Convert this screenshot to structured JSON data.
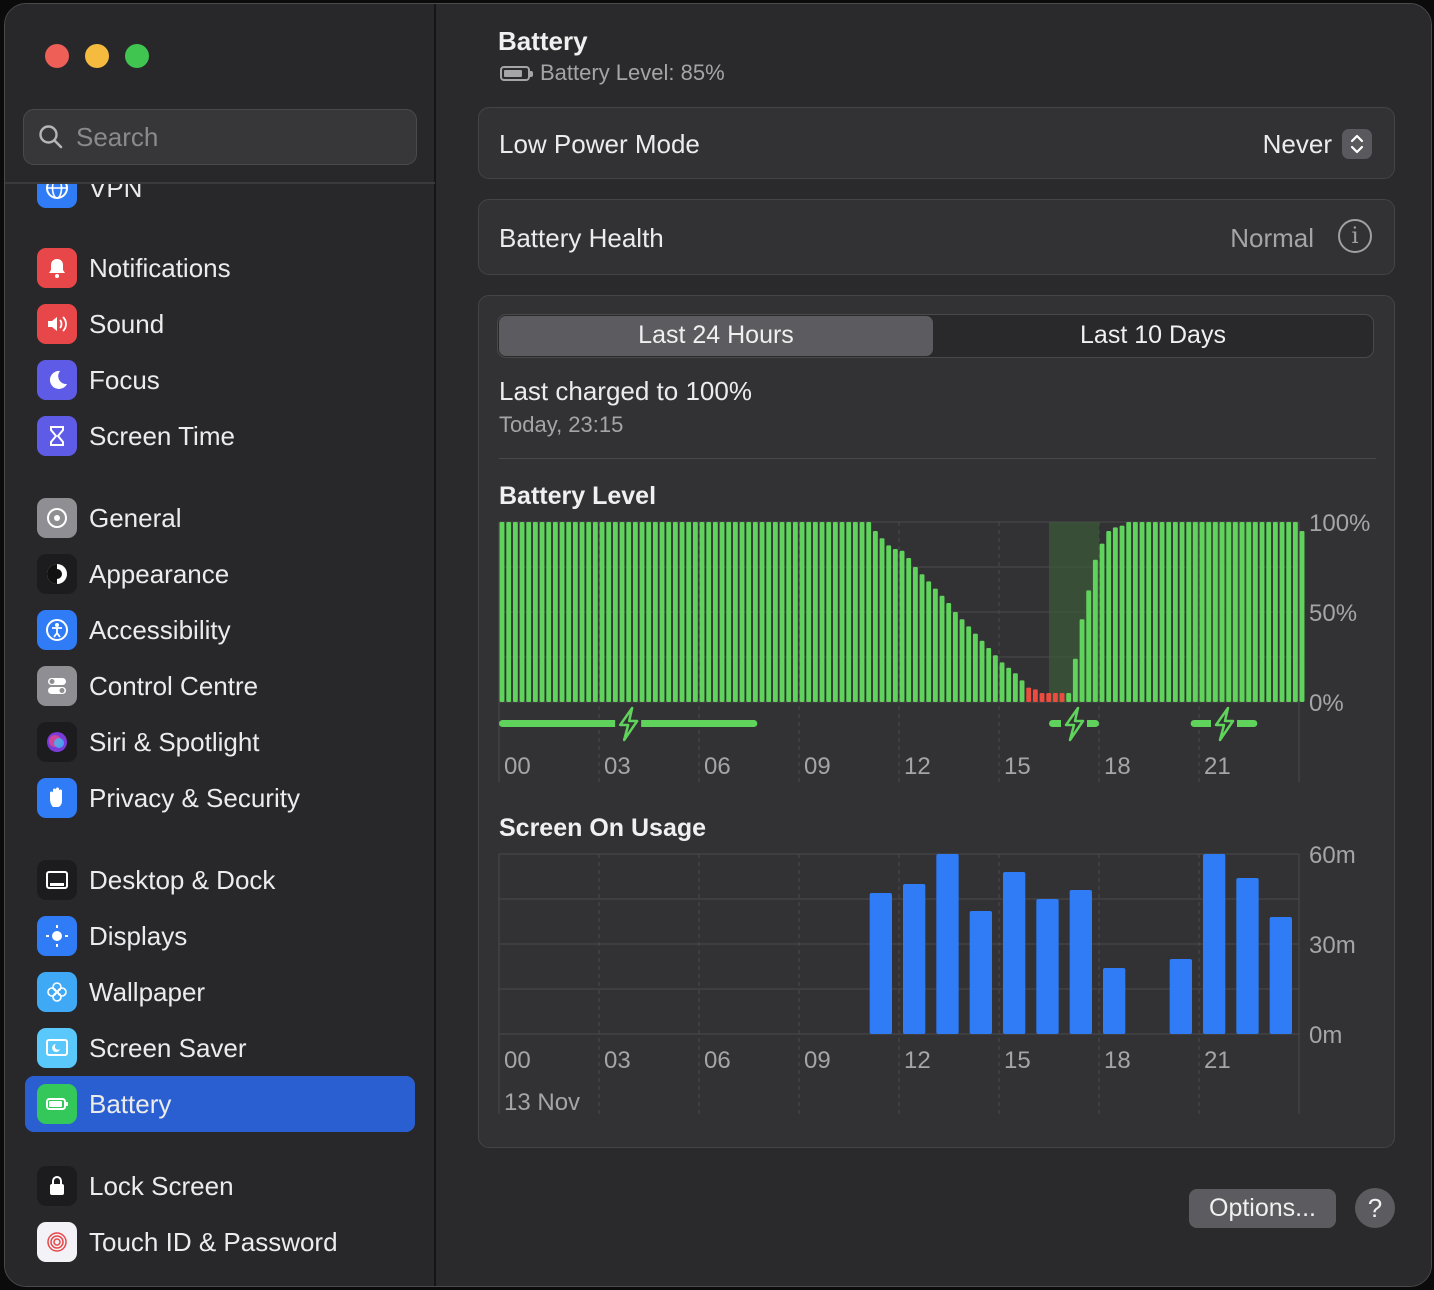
{
  "sidebar": {
    "search_placeholder": "Search",
    "partial_item": "VPN",
    "items": [
      {
        "label": "Notifications",
        "icon": "bell-icon",
        "color": "#e8474a"
      },
      {
        "label": "Sound",
        "icon": "speaker-icon",
        "color": "#e8474a"
      },
      {
        "label": "Focus",
        "icon": "moon-icon",
        "color": "#5e5ce6"
      },
      {
        "label": "Screen Time",
        "icon": "hourglass-icon",
        "color": "#5e5ce6"
      },
      {
        "label": "General",
        "icon": "gear-icon",
        "color": "#8e8e93"
      },
      {
        "label": "Appearance",
        "icon": "appearance-icon",
        "color": "#1c1c1e"
      },
      {
        "label": "Accessibility",
        "icon": "accessibility-icon",
        "color": "#2f7cf6"
      },
      {
        "label": "Control Centre",
        "icon": "toggles-icon",
        "color": "#8e8e93"
      },
      {
        "label": "Siri & Spotlight",
        "icon": "siri-icon",
        "color": "#1c1c1e"
      },
      {
        "label": "Privacy & Security",
        "icon": "hand-icon",
        "color": "#2f7cf6"
      },
      {
        "label": "Desktop & Dock",
        "icon": "dock-icon",
        "color": "#1c1c1e"
      },
      {
        "label": "Displays",
        "icon": "sun-icon",
        "color": "#2f7cf6"
      },
      {
        "label": "Wallpaper",
        "icon": "flower-icon",
        "color": "#3fa9f5"
      },
      {
        "label": "Screen Saver",
        "icon": "screensaver-icon",
        "color": "#5ac8fa"
      },
      {
        "label": "Battery",
        "icon": "battery-icon",
        "color": "#34c759"
      },
      {
        "label": "Lock Screen",
        "icon": "lock-icon",
        "color": "#1c1c1e"
      },
      {
        "label": "Touch ID & Password",
        "icon": "fingerprint-icon",
        "color": "#f2f2f7"
      }
    ],
    "active": "Battery"
  },
  "header": {
    "title": "Battery",
    "subtitle": "Battery Level: 85%"
  },
  "low_power": {
    "label": "Low Power Mode",
    "value": "Never"
  },
  "health": {
    "label": "Battery Health",
    "value": "Normal"
  },
  "tabs": {
    "items": [
      "Last 24 Hours",
      "Last 10 Days"
    ],
    "selected": "Last 24 Hours"
  },
  "last_charged": {
    "title": "Last charged to 100%",
    "time": "Today, 23:15"
  },
  "buttons": {
    "options": "Options...",
    "help": "?"
  },
  "colors": {
    "battery_bar": "#5fd35b",
    "battery_low": "#ec4b3f",
    "usage_bar": "#2f7cf6",
    "accent": "#2a5fd1"
  },
  "chart_data": [
    {
      "type": "bar",
      "title": "Battery Level",
      "x_ticks": [
        "00",
        "03",
        "06",
        "09",
        "12",
        "15",
        "18",
        "21"
      ],
      "y_ticks": [
        "100%",
        "50%",
        "0%"
      ],
      "ylim": [
        0,
        100
      ],
      "unit": "%",
      "interval_minutes": 15,
      "values": [
        100,
        100,
        100,
        100,
        100,
        100,
        100,
        100,
        100,
        100,
        100,
        100,
        100,
        100,
        100,
        100,
        100,
        100,
        100,
        100,
        100,
        100,
        100,
        100,
        100,
        100,
        100,
        100,
        100,
        100,
        100,
        100,
        100,
        100,
        100,
        100,
        100,
        100,
        100,
        100,
        100,
        100,
        100,
        100,
        100,
        100,
        100,
        100,
        100,
        100,
        100,
        100,
        100,
        100,
        100,
        100,
        95,
        91,
        87,
        85,
        84,
        80,
        75,
        71,
        67,
        63,
        59,
        55,
        50,
        46,
        42,
        38,
        34,
        30,
        26,
        22,
        19,
        16,
        12,
        8,
        7,
        5,
        5,
        5,
        5,
        5,
        24,
        46,
        62,
        79,
        88,
        95,
        97,
        98,
        100,
        100,
        100,
        100,
        100,
        100,
        100,
        100,
        100,
        100,
        100,
        100,
        100,
        100,
        100,
        100,
        100,
        100,
        100,
        100,
        100,
        100,
        100,
        100,
        100,
        100,
        95
      ],
      "low_bar_indices": [
        79,
        80,
        81,
        82,
        83,
        84
      ],
      "charging_periods": [
        [
          "00:00",
          "07:45"
        ],
        [
          "16:30",
          "18:00"
        ],
        [
          "20:45",
          "22:45"
        ]
      ]
    },
    {
      "type": "bar",
      "title": "Screen On Usage",
      "x_ticks": [
        "00",
        "03",
        "06",
        "09",
        "12",
        "15",
        "18",
        "21"
      ],
      "y_ticks": [
        "60m",
        "30m",
        "0m"
      ],
      "ylim": [
        0,
        60
      ],
      "unit": "minutes",
      "categories": [
        "00",
        "01",
        "02",
        "03",
        "04",
        "05",
        "06",
        "07",
        "08",
        "09",
        "10",
        "11",
        "12",
        "13",
        "14",
        "15",
        "16",
        "17",
        "18",
        "19",
        "20",
        "21",
        "22",
        "23"
      ],
      "values": [
        0,
        0,
        0,
        0,
        0,
        0,
        0,
        0,
        0,
        0,
        0,
        47,
        50,
        60,
        41,
        54,
        45,
        48,
        22,
        0,
        25,
        60,
        52,
        39
      ],
      "date_label": "13 Nov"
    }
  ]
}
